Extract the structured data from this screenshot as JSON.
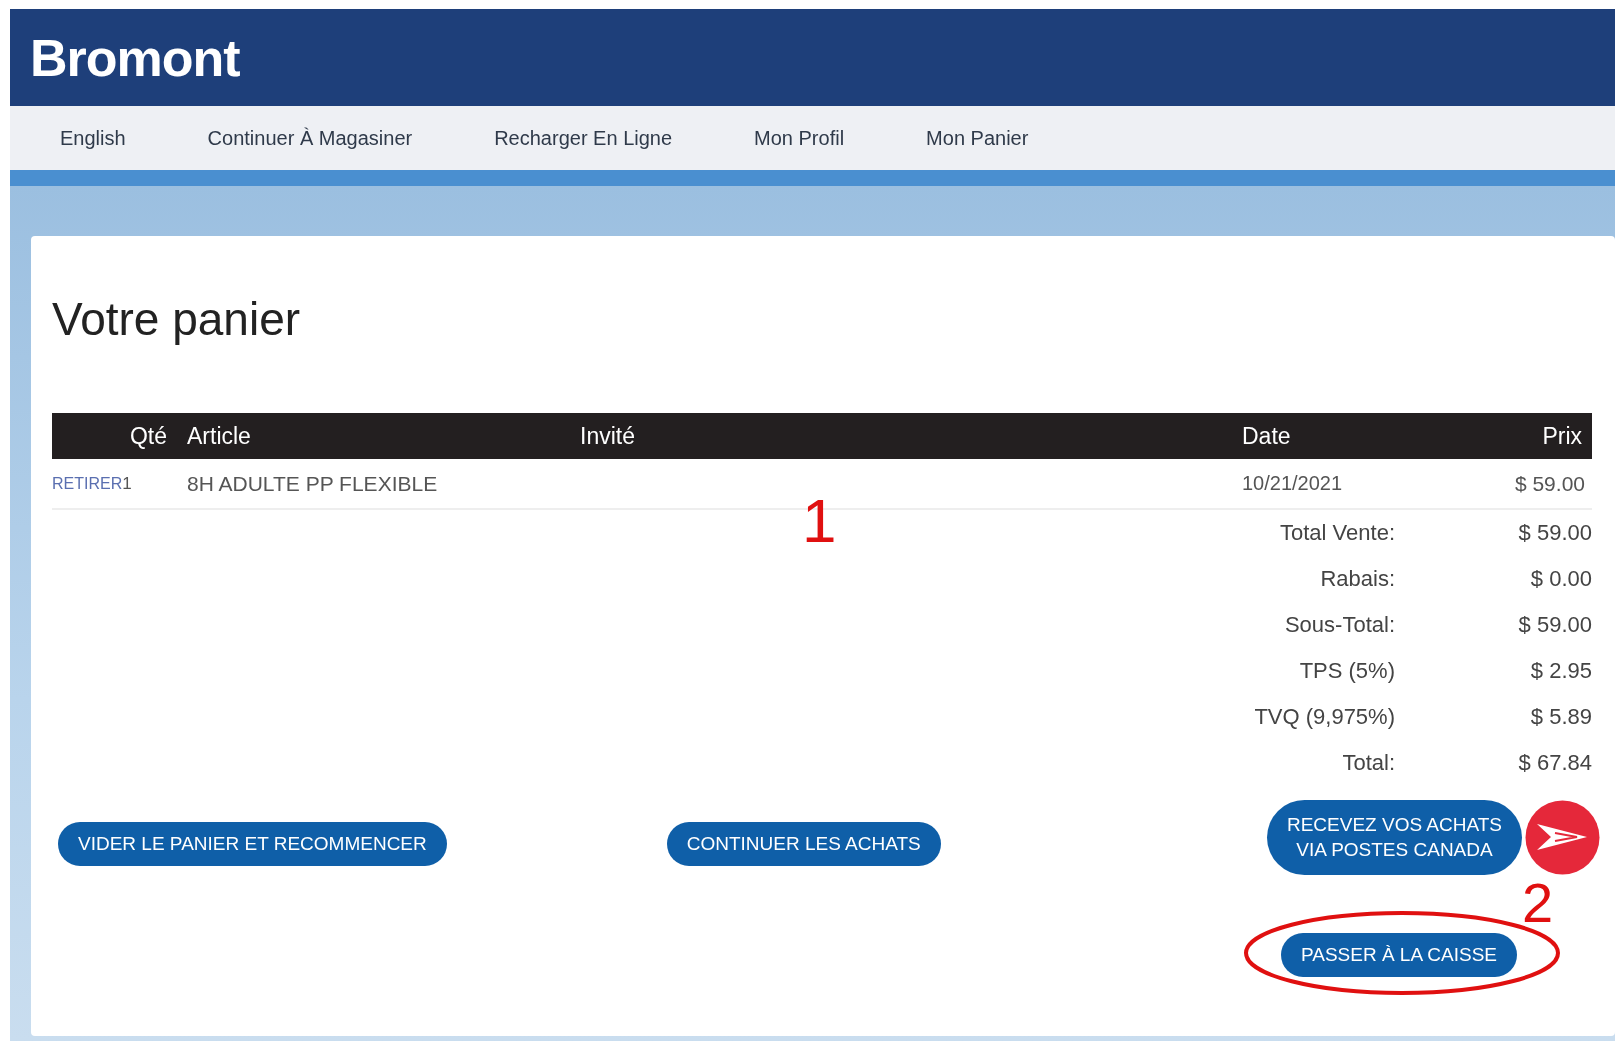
{
  "header": {
    "logo": "Bromont"
  },
  "nav": {
    "items": [
      {
        "label": "English"
      },
      {
        "label": "Continuer À Magasiner"
      },
      {
        "label": "Recharger En Ligne"
      },
      {
        "label": "Mon Profil"
      },
      {
        "label": "Mon Panier"
      }
    ]
  },
  "cart": {
    "title": "Votre panier",
    "table": {
      "columns": [
        "Qté",
        "Article",
        "Invité",
        "Date",
        "Prix"
      ],
      "rows": [
        {
          "remove_link": "RETIRER",
          "qty": "1",
          "article": "8H ADULTE PP FLEXIBLE",
          "date": "10/21/2021",
          "price": "$ 59.00"
        }
      ]
    },
    "totals": [
      {
        "label": "Total Vente:",
        "value": "$ 59.00"
      },
      {
        "label": "Rabais:",
        "value": "$ 0.00"
      },
      {
        "label": "Sous-Total:",
        "value": "$ 59.00"
      },
      {
        "label": "TPS (5%)",
        "value": "$ 2.95"
      },
      {
        "label": "TVQ (9,975%)",
        "value": "$ 5.89"
      },
      {
        "label": "Total:",
        "value": "$ 67.84"
      }
    ],
    "buttons": {
      "empty_cart": "VIDER LE PANIER ET RECOMMENCER",
      "continue": "CONTINUER LES ACHATS",
      "shipping": [
        "RECEVEZ VOS ACHATS",
        "VIA POSTES CANADA"
      ],
      "checkout": "PASSER À LA CAISSE"
    }
  },
  "annotations": [
    "1",
    "2"
  ]
}
